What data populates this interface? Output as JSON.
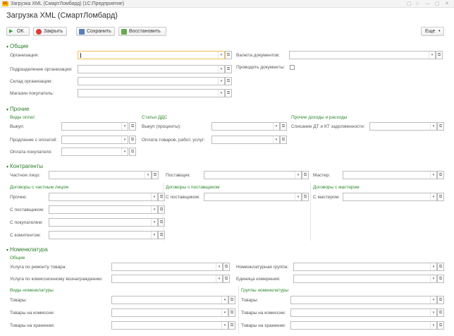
{
  "window": {
    "title": "Загрузка XML (СмартЛомбард)  (1С:Предприятие)",
    "logo": "1С"
  },
  "form": {
    "title": "Загрузка XML (СмартЛомбард)"
  },
  "toolbar": {
    "ok": "ОК",
    "close": "Закрыть",
    "save": "Сохранить",
    "restore": "Восстановить",
    "more": "Еще"
  },
  "general": {
    "title": "Общие",
    "organization": "Организация:",
    "subdivision": "Подразделение организации:",
    "warehouse": "Склад организации:",
    "buyer_store": "Магазин покупатель:",
    "currency": "Валюта документов:",
    "post_docs": "Проводить документы:"
  },
  "other": {
    "title": "Прочие",
    "payment_types": "Виды оплат",
    "redemption": "Выкуп:",
    "extension": "Продление с оплатой:",
    "buyer_payment": "Оплата покупателя:",
    "cashflow_items": "Статьи ДДС",
    "redemption_interest": "Выкуп (проценты):",
    "goods_payment": "Оплата товаров, работ, услуг:",
    "other_income": "Прочие доходы и расходы",
    "write_off": "Списание ДТ и КТ задолженности:"
  },
  "counterparties": {
    "title": "Контрагенты",
    "individual": "Частное лицо:",
    "supplier": "Поставщик:",
    "master": "Мастер:",
    "contracts_individual": "Договоры с частным лицом",
    "other": "Прочее:",
    "with_supplier": "С поставщиком:",
    "with_buyer": "С покупателем:",
    "with_consignor": "С комитентом:",
    "contracts_supplier": "Договоры с поставщиком",
    "supplier_contract": "С поставщиком:",
    "contracts_master": "Договоры с мастером",
    "with_master": "С мастером:"
  },
  "nomenclature": {
    "title": "Номенклатура",
    "general": "Общие",
    "repair_service": "Услуга по ремонту товара:",
    "commission_service": "Услуга по комиссионному вознаграждению:",
    "nom_group": "Номенклатурная группа:",
    "unit": "Единица измерения:",
    "nom_types": "Виды номенклатуры",
    "goods": "Товары:",
    "goods_commission": "Товары на комиссии:",
    "goods_storage": "Товары на хранении:",
    "nom_groups": "Группы номенклатуры",
    "g_goods": "Товары:",
    "g_goods_commission": "Товары на комиссии:",
    "g_goods_storage": "Товары на хранении:"
  },
  "icons": {
    "dropdown": "▾",
    "open": "⧉",
    "collapse": "▾",
    "window_controls": [
      "▢",
      "☆",
      "—",
      "▢",
      "✕"
    ]
  },
  "colors": {
    "section": "#2c7e2c",
    "active_border": "#f0c050",
    "ok_icon": "#2e9e2e",
    "close_icon": "#d83c3c"
  }
}
